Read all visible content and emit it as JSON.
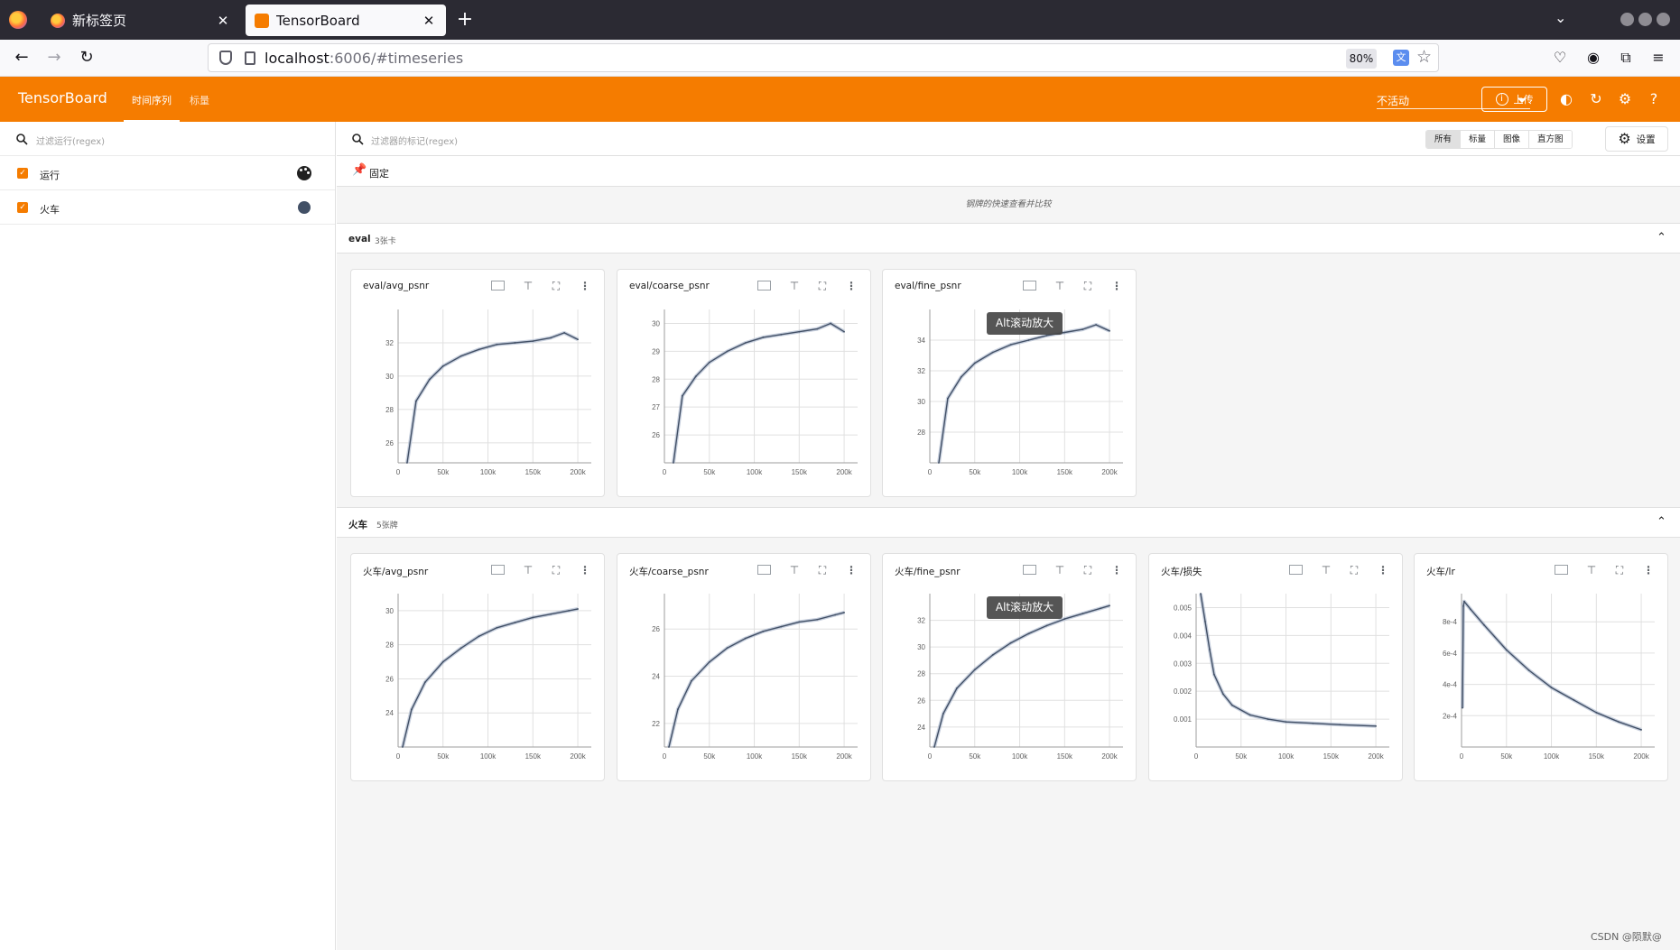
{
  "browser": {
    "tabs": [
      {
        "title": "新标签页",
        "active": false
      },
      {
        "title": "TensorBoard",
        "active": true
      }
    ],
    "new_tab": "+",
    "url_host": "localhost",
    "url_rest": ":6006/#timeseries",
    "zoom": "80%"
  },
  "header": {
    "brand": "TensorBoard",
    "nav": [
      {
        "label": "时间序列",
        "active": true
      },
      {
        "label": "标量",
        "active": false
      }
    ],
    "refresh_select": "不活动",
    "upload_label": "上传"
  },
  "sidebar": {
    "filter_placeholder": "过滤运行(regex)",
    "runs": [
      {
        "label": "运行",
        "checked": true,
        "icon": "palette-icon"
      },
      {
        "label": "火车",
        "checked": true,
        "color": "#425066"
      }
    ]
  },
  "main": {
    "tag_filter_placeholder": "过滤器的标记(regex)",
    "type_filters": [
      "所有",
      "标量",
      "图像",
      "直方图"
    ],
    "type_filter_selected": "所有",
    "settings_label": "设置",
    "pinned_label": "固定",
    "pinned_empty_text": "钢牌的快速查看并比较",
    "groups": [
      {
        "name": "eval",
        "count_label": "3张卡"
      },
      {
        "name": "火车",
        "count_label": "5张牌"
      }
    ],
    "tooltip_text": "Alt滚动放大"
  },
  "cards": [
    {
      "title": "eval/avg_psnr"
    },
    {
      "title": "eval/coarse_psnr"
    },
    {
      "title": "eval/fine_psnr"
    },
    {
      "title": "火车/avg_psnr"
    },
    {
      "title": "火车/coarse_psnr"
    },
    {
      "title": "火车/fine_psnr"
    },
    {
      "title": "火车/损失"
    },
    {
      "title": "火车/lr"
    }
  ],
  "chart_data": [
    {
      "type": "line",
      "title": "eval/avg_psnr",
      "xlim": [
        0,
        215000
      ],
      "ylim": [
        24.8,
        34
      ],
      "x_ticks": [
        "0",
        "50k",
        "100k",
        "150k",
        "200k"
      ],
      "y_ticks": [
        26,
        28,
        30,
        32
      ],
      "series": [
        {
          "color": "#425066",
          "x": [
            10000,
            20000,
            35000,
            50000,
            70000,
            90000,
            110000,
            130000,
            150000,
            170000,
            185000,
            200000
          ],
          "y": [
            24.8,
            28.5,
            29.8,
            30.6,
            31.2,
            31.6,
            31.9,
            32.0,
            32.1,
            32.3,
            32.6,
            32.2
          ]
        }
      ]
    },
    {
      "type": "line",
      "title": "eval/coarse_psnr",
      "xlim": [
        0,
        215000
      ],
      "ylim": [
        25,
        30.5
      ],
      "x_ticks": [
        "0",
        "50k",
        "100k",
        "150k",
        "200k"
      ],
      "y_ticks": [
        26,
        27,
        28,
        29,
        30
      ],
      "series": [
        {
          "color": "#425066",
          "x": [
            10000,
            20000,
            35000,
            50000,
            70000,
            90000,
            110000,
            130000,
            150000,
            170000,
            185000,
            200000
          ],
          "y": [
            25.0,
            27.4,
            28.1,
            28.6,
            29.0,
            29.3,
            29.5,
            29.6,
            29.7,
            29.8,
            30.0,
            29.7
          ]
        }
      ]
    },
    {
      "type": "line",
      "title": "eval/fine_psnr",
      "xlim": [
        0,
        215000
      ],
      "ylim": [
        26,
        36
      ],
      "x_ticks": [
        "0",
        "50k",
        "100k",
        "150k",
        "200k"
      ],
      "y_ticks": [
        28,
        30,
        32,
        34
      ],
      "series": [
        {
          "color": "#425066",
          "x": [
            10000,
            20000,
            35000,
            50000,
            70000,
            90000,
            110000,
            130000,
            150000,
            170000,
            185000,
            200000
          ],
          "y": [
            26.0,
            30.2,
            31.6,
            32.5,
            33.2,
            33.7,
            34.0,
            34.3,
            34.5,
            34.7,
            35.0,
            34.6
          ]
        }
      ]
    },
    {
      "type": "line",
      "title": "火车/avg_psnr",
      "xlim": [
        0,
        215000
      ],
      "ylim": [
        22,
        31
      ],
      "x_ticks": [
        "0",
        "50k",
        "100k",
        "150k",
        "200k"
      ],
      "y_ticks": [
        24,
        26,
        28,
        30
      ],
      "series": [
        {
          "color": "#425066",
          "x": [
            5000,
            15000,
            30000,
            50000,
            70000,
            90000,
            110000,
            130000,
            150000,
            170000,
            190000,
            200000
          ],
          "y": [
            22.0,
            24.2,
            25.8,
            27.0,
            27.8,
            28.5,
            29.0,
            29.3,
            29.6,
            29.8,
            30.0,
            30.1
          ]
        }
      ]
    },
    {
      "type": "line",
      "title": "火车/coarse_psnr",
      "xlim": [
        0,
        215000
      ],
      "ylim": [
        21,
        27.5
      ],
      "x_ticks": [
        "0",
        "50k",
        "100k",
        "150k",
        "200k"
      ],
      "y_ticks": [
        22,
        24,
        26
      ],
      "series": [
        {
          "color": "#425066",
          "x": [
            5000,
            15000,
            30000,
            50000,
            70000,
            90000,
            110000,
            130000,
            150000,
            170000,
            190000,
            200000
          ],
          "y": [
            21.0,
            22.6,
            23.8,
            24.6,
            25.2,
            25.6,
            25.9,
            26.1,
            26.3,
            26.4,
            26.6,
            26.7
          ]
        }
      ]
    },
    {
      "type": "line",
      "title": "火车/fine_psnr",
      "xlim": [
        0,
        215000
      ],
      "ylim": [
        22.5,
        34
      ],
      "x_ticks": [
        "0",
        "50k",
        "100k",
        "150k",
        "200k"
      ],
      "y_ticks": [
        24,
        26,
        28,
        30,
        32
      ],
      "series": [
        {
          "color": "#425066",
          "x": [
            5000,
            15000,
            30000,
            50000,
            70000,
            90000,
            110000,
            130000,
            150000,
            170000,
            190000,
            200000
          ],
          "y": [
            22.5,
            25.0,
            26.9,
            28.3,
            29.4,
            30.3,
            31.0,
            31.6,
            32.1,
            32.5,
            32.9,
            33.1
          ]
        }
      ]
    },
    {
      "type": "line",
      "title": "火车/损失",
      "xlim": [
        0,
        215000
      ],
      "ylim": [
        0,
        0.0055
      ],
      "x_ticks": [
        "0",
        "50k",
        "100k",
        "150k",
        "200k"
      ],
      "y_ticks": [
        "0.001",
        "0.002",
        "0.003",
        "0.004",
        "0.005"
      ],
      "series": [
        {
          "color": "#425066",
          "x": [
            5000,
            10000,
            15000,
            20000,
            30000,
            40000,
            60000,
            80000,
            100000,
            130000,
            160000,
            200000
          ],
          "y": [
            0.0055,
            0.0045,
            0.0035,
            0.0026,
            0.0019,
            0.0015,
            0.00115,
            0.001,
            0.0009,
            0.00085,
            0.0008,
            0.00075
          ]
        }
      ]
    },
    {
      "type": "line",
      "title": "火车/lr",
      "xlim": [
        0,
        215000
      ],
      "ylim": [
        0,
        0.00098
      ],
      "x_ticks": [
        "0",
        "50k",
        "100k",
        "150k",
        "200k"
      ],
      "y_ticks": [
        "2e-4",
        "4e-4",
        "6e-4",
        "8e-4"
      ],
      "series": [
        {
          "color": "#425066",
          "x": [
            1000,
            2000,
            3000,
            10000,
            25000,
            50000,
            75000,
            100000,
            125000,
            150000,
            175000,
            200000
          ],
          "y": [
            0.00025,
            0.0009,
            0.00093,
            0.00088,
            0.00078,
            0.00062,
            0.00049,
            0.00038,
            0.0003,
            0.00022,
            0.00016,
            0.00011
          ]
        }
      ]
    }
  ],
  "watermark": "CSDN @陨默@"
}
